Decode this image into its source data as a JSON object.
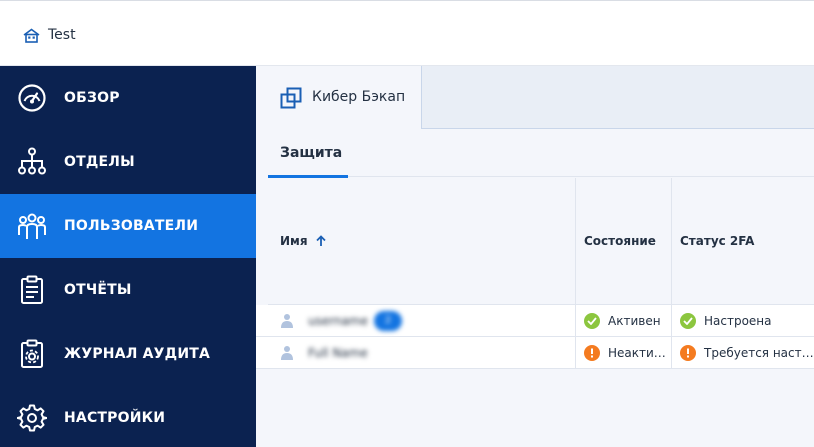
{
  "header": {
    "tenant_name": "Test"
  },
  "sidebar": {
    "items": [
      {
        "label": "ОБЗОР",
        "icon": "dashboard-gauge-icon",
        "active": false
      },
      {
        "label": "ОТДЕЛЫ",
        "icon": "org-tree-icon",
        "active": false
      },
      {
        "label": "ПОЛЬЗОВАТЕЛИ",
        "icon": "users-group-icon",
        "active": true
      },
      {
        "label": "ОТЧЁТЫ",
        "icon": "clipboard-report-icon",
        "active": false
      },
      {
        "label": "ЖУРНАЛ АУДИТА",
        "icon": "audit-log-icon",
        "active": false
      },
      {
        "label": "НАСТРОЙКИ",
        "icon": "gear-icon",
        "active": false
      }
    ]
  },
  "product_tab": {
    "label": "Кибер Бэкап",
    "icon": "cyber-backup-icon"
  },
  "subtab": {
    "label": "Защита"
  },
  "table": {
    "columns": [
      {
        "label": "Имя",
        "sort": "ascending"
      },
      {
        "label": "Состояние"
      },
      {
        "label": "Статус 2FA"
      }
    ],
    "rows": [
      {
        "name": "username",
        "badge": "2",
        "state": "Активен",
        "state_color": "#8cc63f",
        "status_2fa": "Настроена",
        "status_2fa_color": "#8cc63f"
      },
      {
        "name": "Full Name",
        "badge": "",
        "state": "Неакти…",
        "state_color": "#f47b20",
        "status_2fa": "Требуется наст…",
        "status_2fa_color": "#f47b20"
      }
    ]
  },
  "colors": {
    "sidebar_bg": "#0b2250",
    "accent": "#1374e1",
    "ok": "#8cc63f",
    "warn": "#f47b20"
  }
}
